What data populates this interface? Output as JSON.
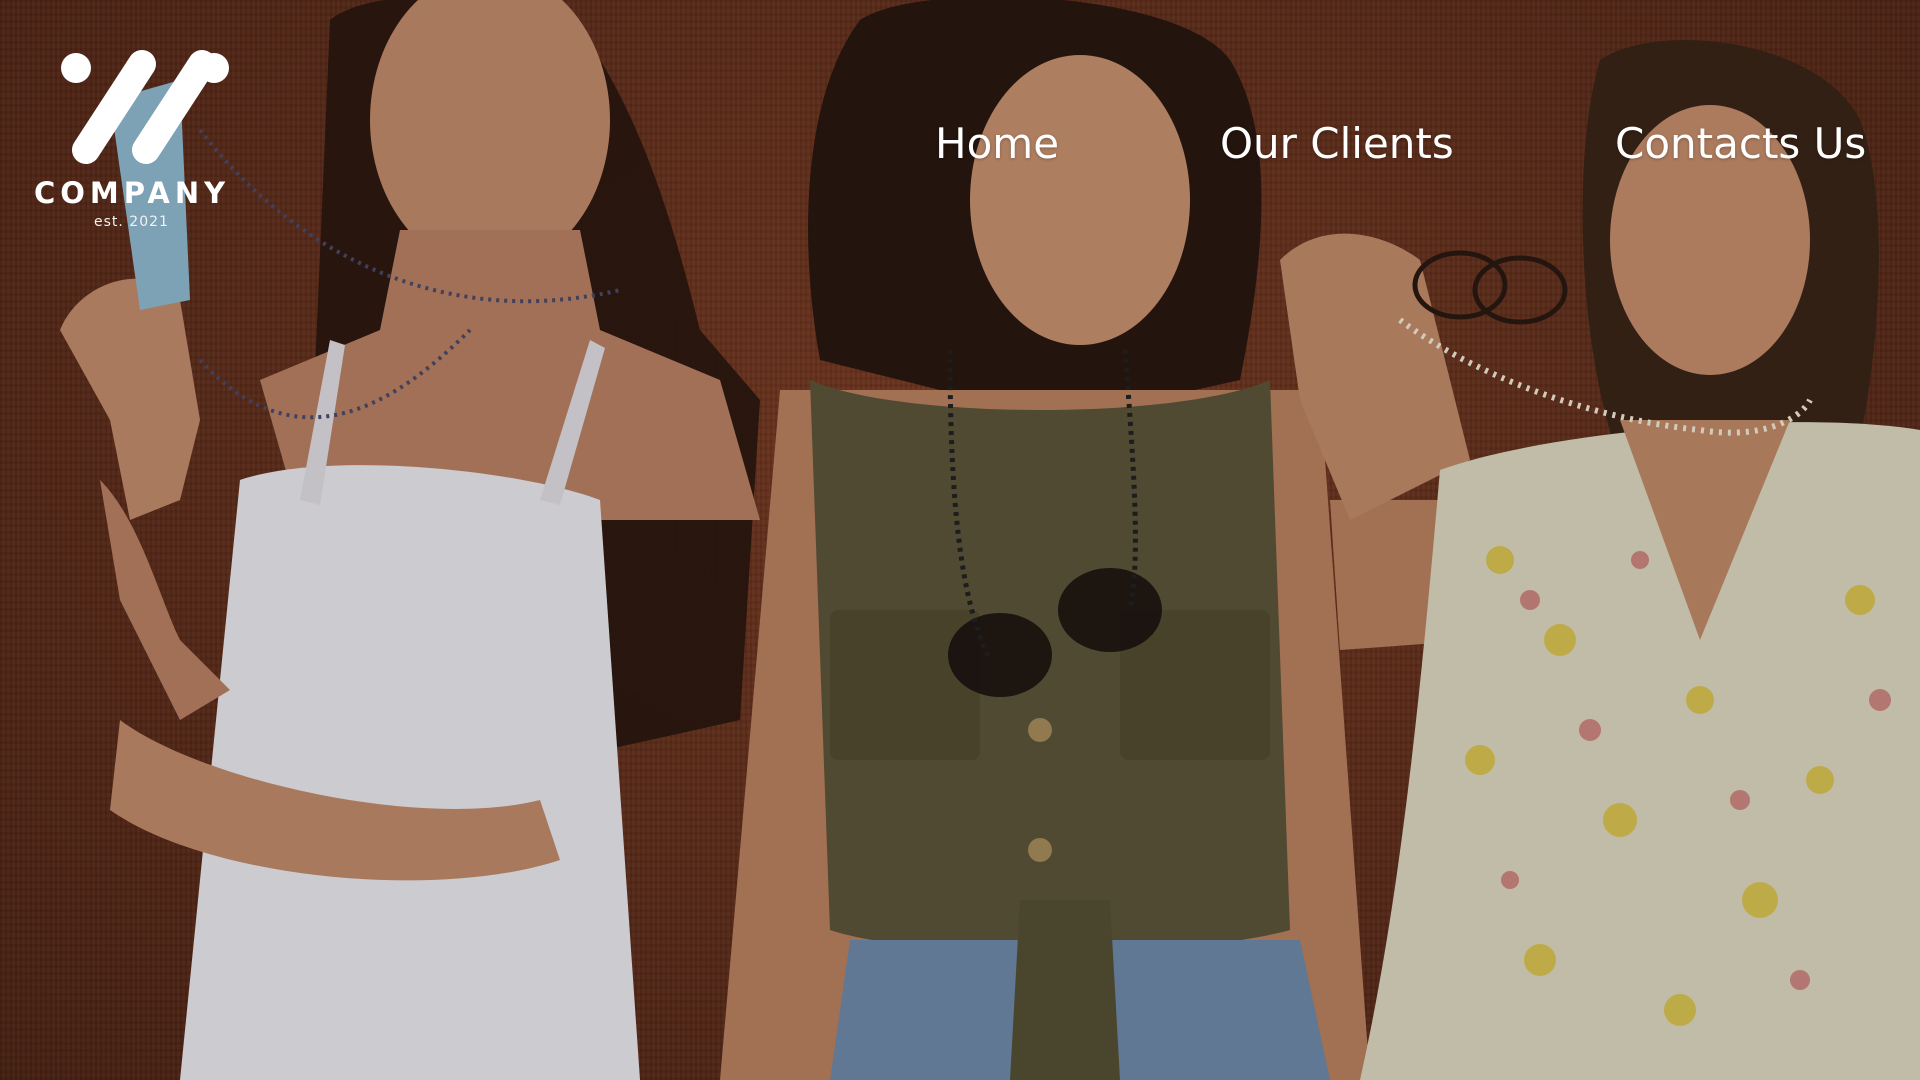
{
  "brand": {
    "name": "COMPANY",
    "tagline": "est. 2021",
    "logo_icon": "slash-dots-logo"
  },
  "nav": {
    "items": [
      {
        "label": "Home"
      },
      {
        "label": "Our Clients"
      },
      {
        "label": "Contacts Us"
      }
    ]
  },
  "hero": {
    "image": "three-women-posing-wearing-beaded-chains",
    "background_color": "#6b2f1a"
  },
  "colors": {
    "nav_text": "#ffffff",
    "wall": "#6b2f1a"
  }
}
